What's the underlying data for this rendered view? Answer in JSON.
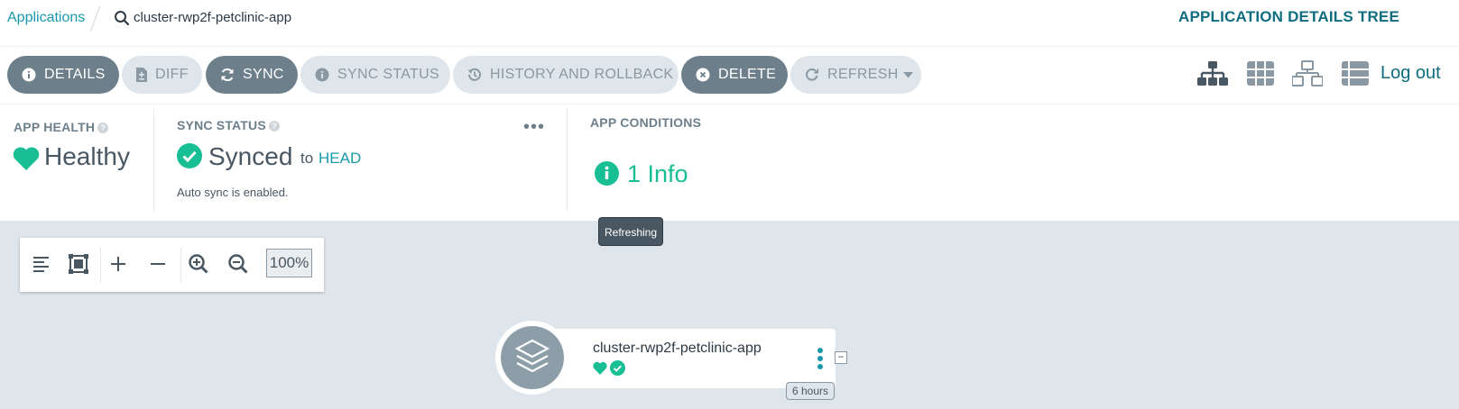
{
  "breadcrumb": {
    "link_label": "Applications",
    "current": "cluster-rwp2f-petclinic-app"
  },
  "page_title": "APPLICATION DETAILS TREE",
  "toolbar": {
    "details": "DETAILS",
    "diff": "DIFF",
    "sync": "SYNC",
    "sync_status": "SYNC STATUS",
    "history": "HISTORY AND ROLLBACK",
    "delete": "DELETE",
    "refresh": "REFRESH"
  },
  "view_icons": [
    "tree-view-icon",
    "pods-grid-view-icon",
    "network-view-icon",
    "list-view-icon"
  ],
  "logout": "Log out",
  "app_health": {
    "label": "APP HEALTH",
    "value": "Healthy"
  },
  "sync_status": {
    "label": "SYNC STATUS",
    "value": "Synced",
    "to_text": "to",
    "revision": "HEAD",
    "auto_sync": "Auto sync is enabled."
  },
  "app_conditions": {
    "label": "APP CONDITIONS",
    "count": "1 Info"
  },
  "tooltip": "Refreshing",
  "zoom": {
    "level": "100%"
  },
  "node": {
    "name": "cluster-rwp2f-petclinic-app",
    "age": "6 hours",
    "collapse": "−"
  },
  "colors": {
    "accent": "#1a99ab",
    "title": "#0f6d7f",
    "healthy": "#18be94",
    "dark_button": "#6d7f8b",
    "light_button": "#dee6eb",
    "canvas": "#dee6eb"
  }
}
